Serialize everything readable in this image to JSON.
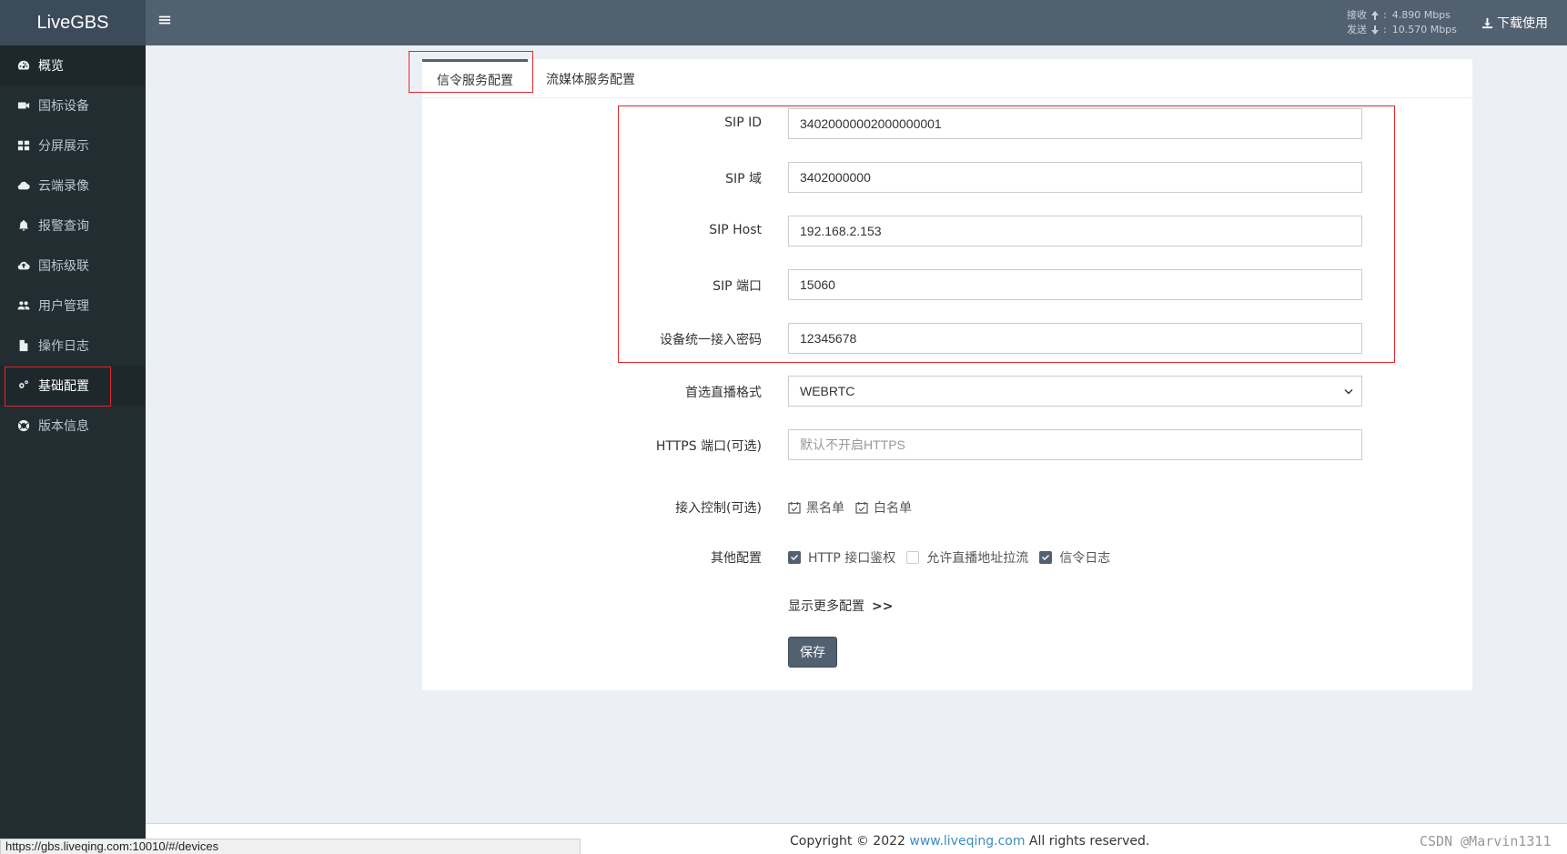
{
  "app": {
    "title": "LiveGBS"
  },
  "sidebar": {
    "items": [
      {
        "label": "概览",
        "icon": "dashboard-icon"
      },
      {
        "label": "国标设备",
        "icon": "video-camera-icon"
      },
      {
        "label": "分屏展示",
        "icon": "grid-icon"
      },
      {
        "label": "云端录像",
        "icon": "cloud-icon"
      },
      {
        "label": "报警查询",
        "icon": "bell-icon"
      },
      {
        "label": "国标级联",
        "icon": "cloud-upload-icon"
      },
      {
        "label": "用户管理",
        "icon": "users-icon"
      },
      {
        "label": "操作日志",
        "icon": "file-icon"
      },
      {
        "label": "基础配置",
        "icon": "gears-icon"
      },
      {
        "label": "版本信息",
        "icon": "life-ring-icon"
      }
    ]
  },
  "header": {
    "recv_label": "接收",
    "recv_value": "4.890 Mbps",
    "send_label": "发送",
    "send_value": "10.570 Mbps",
    "download_label": "下载使用"
  },
  "tabs": [
    {
      "label": "信令服务配置",
      "active": true
    },
    {
      "label": "流媒体服务配置",
      "active": false
    }
  ],
  "form": {
    "sip_id": {
      "label": "SIP ID",
      "value": "34020000002000000001"
    },
    "sip_domain": {
      "label": "SIP 域",
      "value": "3402000000"
    },
    "sip_host": {
      "label": "SIP Host",
      "value": "192.168.2.153"
    },
    "sip_port": {
      "label": "SIP 端口",
      "value": "15060"
    },
    "device_password": {
      "label": "设备统一接入密码",
      "value": "12345678"
    },
    "stream_format": {
      "label": "首选直播格式",
      "value": "WEBRTC"
    },
    "https_port": {
      "label": "HTTPS 端口(可选)",
      "placeholder": "默认不开启HTTPS",
      "value": ""
    },
    "access_control": {
      "label": "接入控制(可选)",
      "blacklist": "黑名单",
      "whitelist": "白名单"
    },
    "other": {
      "label": "其他配置",
      "http_auth": {
        "label": "HTTP 接口鉴权",
        "checked": true
      },
      "allow_pull": {
        "label": "允许直播地址拉流",
        "checked": false
      },
      "sip_log": {
        "label": "信令日志",
        "checked": true
      }
    },
    "more_label": "显示更多配置",
    "more_arrow": ">>",
    "save_label": "保存"
  },
  "footer": {
    "copyright_prefix": "Copyright © 2022 ",
    "link": "www.liveqing.com",
    "copyright_suffix": " All rights reserved.",
    "watermark": "CSDN @Marvin1311"
  },
  "status_url": "https://gbs.liveqing.com:10010/#/devices",
  "colors": {
    "accent": "#526170",
    "sidebar": "#222d32",
    "highlight": "#e0292b"
  }
}
